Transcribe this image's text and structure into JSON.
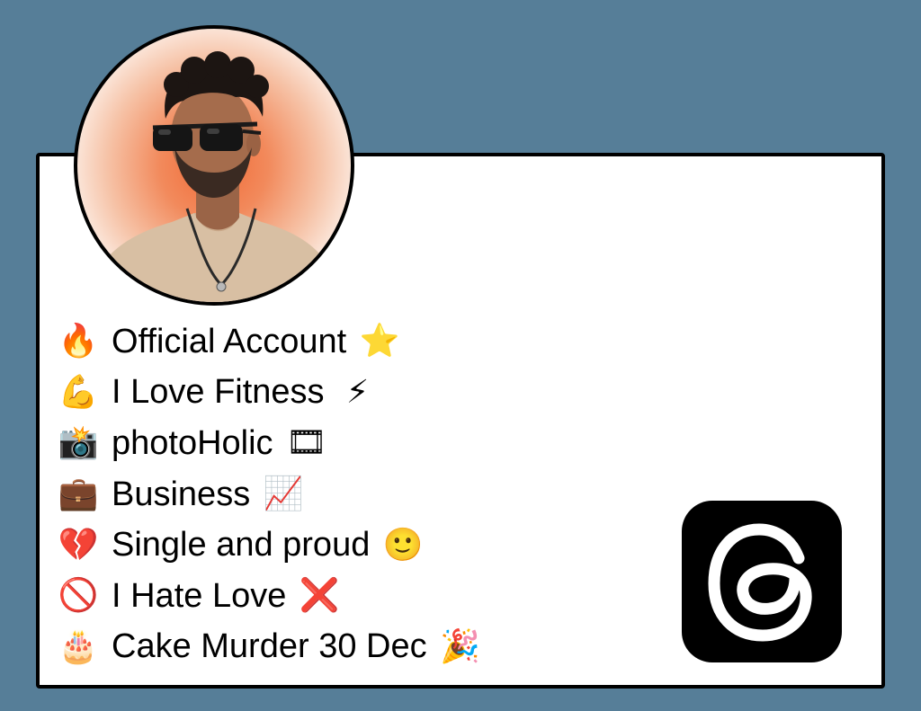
{
  "profile": {
    "avatar_alt": "profile photo"
  },
  "bio": {
    "lines": [
      {
        "lead_icon": "fire-emoji",
        "lead": "🔥",
        "text": "Official Account",
        "trail_icon": "star-emoji",
        "trail": "⭐"
      },
      {
        "lead_icon": "flexed-biceps-emoji",
        "lead": "💪",
        "text": "I Love Fitness",
        "trail_icon": "lightning-emoji",
        "trail": "⚡"
      },
      {
        "lead_icon": "camera-flash-emoji",
        "lead": "📸",
        "text": "photoHolic",
        "trail_icon": "film-frames-emoji",
        "trail": "🎞"
      },
      {
        "lead_icon": "briefcase-emoji",
        "lead": "💼",
        "text": "Business",
        "trail_icon": "chart-increasing-emoji",
        "trail": "📈"
      },
      {
        "lead_icon": "broken-heart-emoji",
        "lead": "💔",
        "text": "Single and proud",
        "trail_icon": "smiling-face-emoji",
        "trail": "🙂"
      },
      {
        "lead_icon": "prohibited-emoji",
        "lead": "🚫",
        "text": "I Hate Love",
        "trail_icon": "cross-mark-emoji",
        "trail": "❌"
      },
      {
        "lead_icon": "birthday-cake-emoji",
        "lead": "🎂",
        "text": "Cake Murder 30 Dec",
        "trail_icon": "party-popper-emoji",
        "trail": "🎉"
      }
    ]
  },
  "logo": {
    "icon": "threads-logo-icon"
  },
  "colors": {
    "background": "#567e98",
    "card": "#ffffff",
    "border": "#000000",
    "avatar_glow": "#f06a36",
    "logo_bg": "#000000",
    "logo_fg": "#ffffff"
  }
}
